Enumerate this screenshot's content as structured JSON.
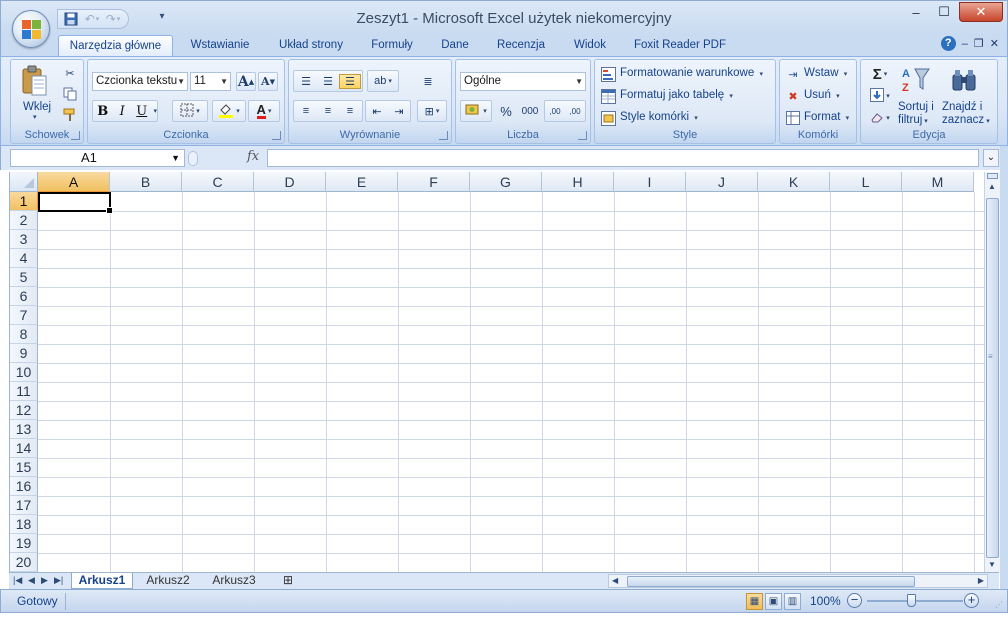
{
  "window": {
    "title": "Zeszyt1 - Microsoft Excel użytek niekomercyjny",
    "controls": {
      "minimize": "–",
      "maximize": "☐",
      "close": "✕"
    }
  },
  "qat": {
    "save_icon": "save-icon",
    "undo_icon": "undo-icon",
    "redo_icon": "redo-icon",
    "customize": "▾"
  },
  "tabs": [
    {
      "label": "Narzędzia główne",
      "active": true
    },
    {
      "label": "Wstawianie"
    },
    {
      "label": "Układ strony"
    },
    {
      "label": "Formuły"
    },
    {
      "label": "Dane"
    },
    {
      "label": "Recenzja"
    },
    {
      "label": "Widok"
    },
    {
      "label": "Foxit Reader PDF"
    }
  ],
  "ribbon_help": {
    "help": "?",
    "minimize": "–",
    "restore": "❐",
    "close": "✕"
  },
  "groups": {
    "clipboard": {
      "label": "Schowek",
      "paste": "Wklej"
    },
    "font": {
      "label": "Czcionka",
      "font_name": "Czcionka tekstu",
      "font_size": "11",
      "bold": "B",
      "italic": "I",
      "underline": "U",
      "grow": "A",
      "shrink": "A"
    },
    "alignment": {
      "label": "Wyrównanie"
    },
    "number": {
      "label": "Liczba",
      "format": "Ogólne",
      "percent": "%",
      "thousands": "000",
      "inc_dec": ",00",
      "dec_dec": ",00"
    },
    "styles": {
      "label": "Style",
      "conditional": "Formatowanie warunkowe",
      "as_table": "Formatuj jako tabelę",
      "cell_styles": "Style komórki"
    },
    "cells": {
      "label": "Komórki",
      "insert": "Wstaw",
      "delete": "Usuń",
      "format": "Format"
    },
    "editing": {
      "label": "Edycja",
      "sum": "Σ",
      "sort_line1": "Sortuj i",
      "sort_line2": "filtruj",
      "find_line1": "Znajdź i",
      "find_line2": "zaznacz"
    }
  },
  "formula_bar": {
    "name_box": "A1",
    "fx": "fx",
    "value": ""
  },
  "grid": {
    "columns": [
      "A",
      "B",
      "C",
      "D",
      "E",
      "F",
      "G",
      "H",
      "I",
      "J",
      "K",
      "L",
      "M"
    ],
    "rows": [
      "1",
      "2",
      "3",
      "4",
      "5",
      "6",
      "7",
      "8",
      "9",
      "10",
      "11",
      "12",
      "13",
      "14",
      "15",
      "16",
      "17",
      "18",
      "19",
      "20"
    ],
    "active_cell": "A1"
  },
  "sheets": [
    {
      "label": "Arkusz1",
      "active": true
    },
    {
      "label": "Arkusz2"
    },
    {
      "label": "Arkusz3"
    }
  ],
  "status": {
    "text": "Gotowy",
    "zoom": "100%"
  },
  "colors": {
    "accent": "#15428b",
    "ribbon_bg": "#dbe7f7",
    "selected_header": "#f1c15f"
  }
}
